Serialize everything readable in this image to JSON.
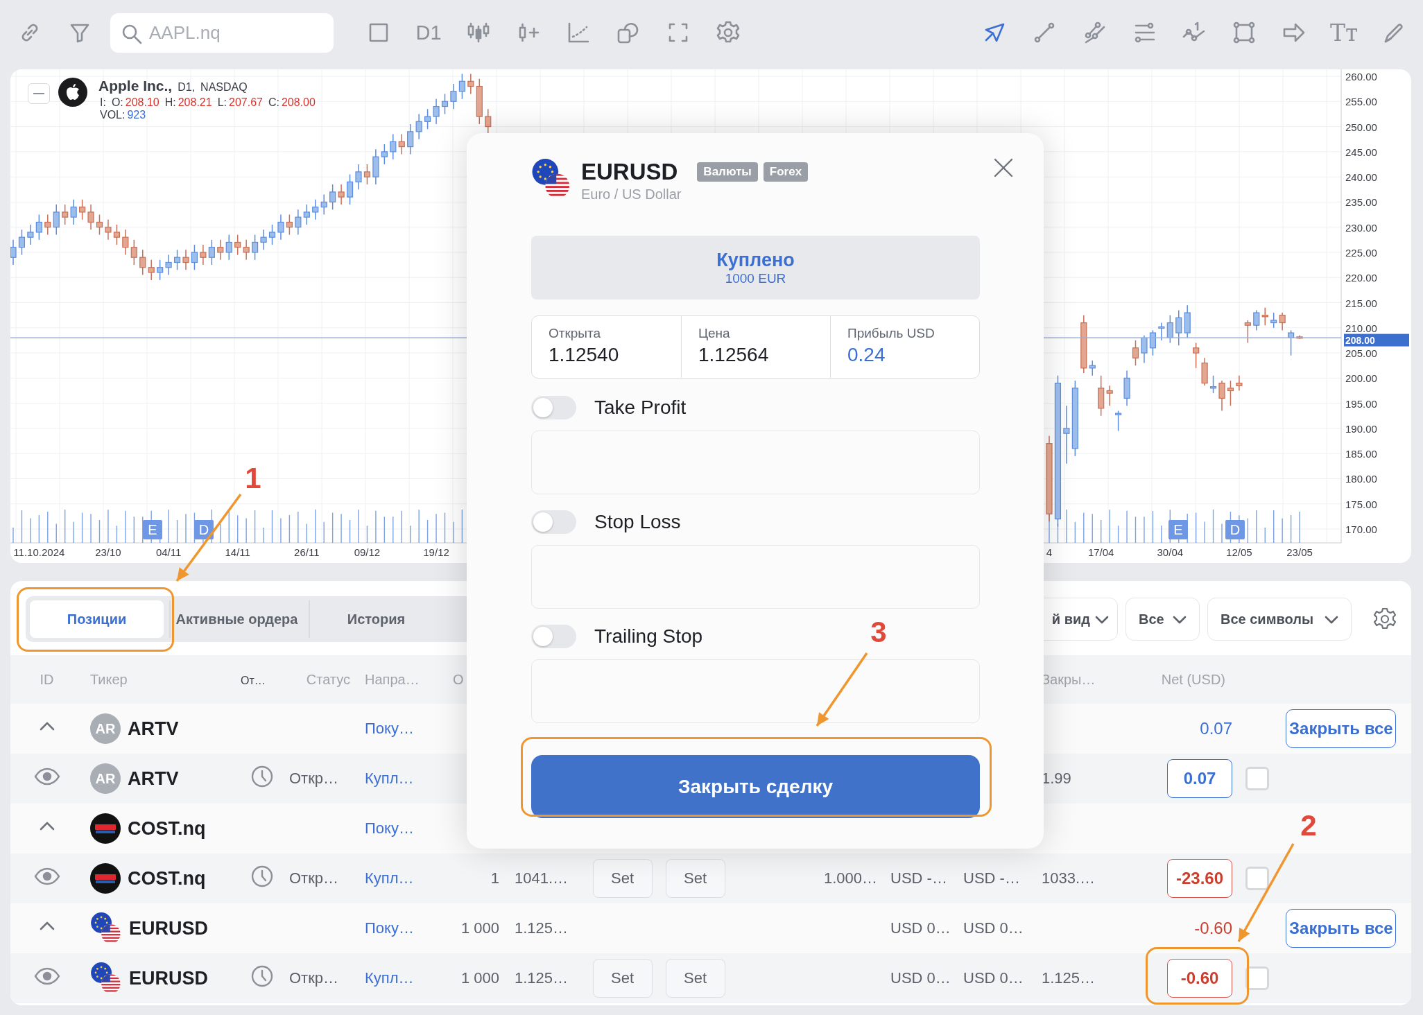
{
  "toolbar": {
    "search": {
      "placeholder": "AAPL.nq"
    },
    "timeframe": "D1",
    "tools": [
      {
        "selected": true
      },
      {
        "selected": false
      },
      {
        "selected": false
      },
      {
        "selected": false
      },
      {
        "selected": false
      },
      {
        "selected": false
      },
      {
        "selected": false
      },
      {
        "selected": false,
        "glyph": "Tт"
      },
      {
        "selected": false
      }
    ]
  },
  "chart": {
    "symbol": "Apple Inc.,",
    "timeframe": "D1,",
    "exchange": "NASDAQ",
    "prefix": "I:",
    "ohlc": [
      {
        "label": "O:",
        "value": "208.10"
      },
      {
        "label": "H:",
        "value": "208.21"
      },
      {
        "label": "L:",
        "value": "207.67"
      },
      {
        "label": "C:",
        "value": "208.00"
      }
    ],
    "volume": {
      "label": "VOL:",
      "value": "923"
    },
    "last_price": "208.00",
    "events": [
      {
        "label": "E"
      },
      {
        "label": "D"
      },
      {
        "label": "E"
      },
      {
        "label": "D"
      }
    ],
    "chart_data": {
      "type": "candlestick",
      "ylim": [
        167.25,
        261.38
      ],
      "grid": true,
      "ref_lines": [
        {
          "value": 208,
          "axis": "y"
        }
      ],
      "yticks": [
        {
          "value": 260,
          "label": "260.00"
        },
        {
          "value": 255,
          "label": "255.00"
        },
        {
          "value": 250,
          "label": "250.00"
        },
        {
          "value": 245,
          "label": "245.00"
        },
        {
          "value": 240,
          "label": "240.00"
        },
        {
          "value": 235,
          "label": "235.00"
        },
        {
          "value": 230,
          "label": "230.00"
        },
        {
          "value": 225,
          "label": "225.00"
        },
        {
          "value": 220,
          "label": "220.00"
        },
        {
          "value": 215,
          "label": "215.00"
        },
        {
          "value": 210,
          "label": "210.00"
        },
        {
          "value": 205,
          "label": "205.00"
        },
        {
          "value": 200,
          "label": "200.00"
        },
        {
          "value": 195,
          "label": "195.00"
        },
        {
          "value": 190,
          "label": "190.00"
        },
        {
          "value": 185,
          "label": "185.00"
        },
        {
          "value": 180,
          "label": "180.00"
        },
        {
          "value": 175,
          "label": "175.00"
        },
        {
          "value": 170,
          "label": "170.00"
        }
      ],
      "categories": [
        null,
        null,
        null,
        "11.10.2024",
        null,
        null,
        null,
        null,
        null,
        null,
        null,
        "23/10",
        null,
        null,
        null,
        null,
        null,
        null,
        "04/11",
        null,
        null,
        null,
        null,
        null,
        null,
        null,
        "14/11",
        null,
        null,
        null,
        null,
        null,
        null,
        null,
        "26/11",
        null,
        null,
        null,
        null,
        null,
        null,
        "09/12",
        null,
        null,
        null,
        null,
        null,
        null,
        null,
        "19/12",
        null,
        null,
        null,
        null,
        null,
        null,
        null,
        null,
        null,
        null,
        null,
        null,
        null,
        null,
        null,
        null,
        null,
        null,
        null,
        null,
        null,
        null,
        null,
        null,
        null,
        null,
        null,
        null,
        null,
        null,
        null,
        null,
        null,
        null,
        null,
        null,
        null,
        null,
        null,
        null,
        null,
        null,
        null,
        null,
        null,
        null,
        null,
        null,
        null,
        null,
        null,
        null,
        null,
        null,
        null,
        null,
        null,
        null,
        null,
        null,
        null,
        null,
        null,
        null,
        null,
        null,
        null,
        null,
        null,
        null,
        "4",
        null,
        null,
        null,
        null,
        null,
        "17/04",
        null,
        null,
        null,
        null,
        null,
        null,
        null,
        "30/04",
        null,
        null,
        null,
        null,
        null,
        null,
        null,
        "12/05",
        null,
        null,
        null,
        null,
        null,
        null,
        "23/05"
      ],
      "ohlc": [
        [
          224,
          227.5,
          222.5,
          226
        ],
        [
          226,
          229.5,
          224.5,
          228
        ],
        [
          228,
          230.5,
          226.5,
          229
        ],
        [
          229,
          232.5,
          227.5,
          231
        ],
        [
          231,
          232.5,
          228.5,
          230
        ],
        [
          230,
          234.5,
          228.5,
          233
        ],
        [
          233,
          234.5,
          230.5,
          232
        ],
        [
          232,
          235.5,
          230.5,
          234
        ],
        [
          234,
          235.5,
          231.5,
          233
        ],
        [
          233,
          234.5,
          229.5,
          231
        ],
        [
          231,
          232.5,
          228.5,
          230
        ],
        [
          230,
          231.5,
          227.5,
          229
        ],
        [
          229,
          230.5,
          226.5,
          228
        ],
        [
          228,
          229.5,
          224.5,
          226
        ],
        [
          226,
          227.5,
          222.5,
          224
        ],
        [
          224,
          225.5,
          220.5,
          222
        ],
        [
          222,
          223.5,
          219.5,
          221
        ],
        [
          221,
          223.5,
          219.5,
          222
        ],
        [
          222,
          224.5,
          220.5,
          223
        ],
        [
          223,
          225.5,
          221.5,
          224
        ],
        [
          224,
          225.5,
          221.5,
          223
        ],
        [
          223,
          226.5,
          221.5,
          225
        ],
        [
          225,
          226.5,
          222.5,
          224
        ],
        [
          224,
          227.5,
          222.5,
          226
        ],
        [
          226,
          227.5,
          223.5,
          225
        ],
        [
          225,
          228.5,
          223.5,
          227
        ],
        [
          227,
          228.5,
          224.5,
          226
        ],
        [
          226,
          227.5,
          223.5,
          225
        ],
        [
          225,
          228.5,
          223.5,
          227
        ],
        [
          227,
          229.5,
          225.5,
          228
        ],
        [
          228,
          230.5,
          226.5,
          229
        ],
        [
          229,
          232.5,
          227.5,
          231
        ],
        [
          231,
          232.5,
          228.5,
          230
        ],
        [
          230,
          233.5,
          228.5,
          232
        ],
        [
          232,
          234.5,
          230.5,
          233
        ],
        [
          233,
          235.5,
          231.5,
          234
        ],
        [
          234,
          236.5,
          232.5,
          235
        ],
        [
          235,
          238.5,
          233.5,
          237
        ],
        [
          237,
          238.5,
          234.5,
          236
        ],
        [
          236,
          240.5,
          234.5,
          239
        ],
        [
          239,
          242.5,
          237.5,
          241
        ],
        [
          241,
          242.5,
          238.5,
          240
        ],
        [
          240,
          245.5,
          238.5,
          244
        ],
        [
          244,
          246.5,
          242.5,
          245
        ],
        [
          245,
          248.5,
          243.5,
          247
        ],
        [
          247,
          248.5,
          244.5,
          246
        ],
        [
          246,
          250.5,
          244.5,
          249
        ],
        [
          249,
          252.5,
          247.5,
          251
        ],
        [
          251,
          253.5,
          249.5,
          252
        ],
        [
          252,
          255.5,
          250.5,
          254
        ],
        [
          254,
          256.5,
          252.5,
          255
        ],
        [
          255,
          258.5,
          253.5,
          257
        ],
        [
          257,
          260.5,
          255.5,
          259
        ],
        [
          259,
          260.5,
          256.5,
          258
        ],
        [
          258,
          259.5,
          250.5,
          252
        ],
        [
          252,
          253.5,
          248.5,
          250
        ],
        null,
        null,
        null,
        null,
        null,
        null,
        null,
        null,
        null,
        null,
        null,
        null,
        null,
        null,
        null,
        null,
        null,
        null,
        null,
        null,
        null,
        null,
        null,
        null,
        null,
        null,
        null,
        null,
        null,
        null,
        null,
        null,
        null,
        null,
        null,
        null,
        null,
        null,
        null,
        null,
        null,
        null,
        null,
        null,
        null,
        null,
        null,
        null,
        null,
        null,
        null,
        null,
        null,
        null,
        null,
        null,
        null,
        null,
        null,
        null,
        null,
        null,
        null,
        null,
        [
          187,
          188.5,
          171.5,
          173
        ],
        [
          172,
          200.5,
          170.5,
          199
        ],
        [
          189,
          194.5,
          183,
          190
        ],
        [
          186,
          199.5,
          184.5,
          198
        ],
        [
          211,
          212.5,
          201,
          202
        ],
        [
          202,
          203.5,
          200.5,
          202.5
        ],
        [
          198,
          200.5,
          192.5,
          194
        ],
        [
          197.5,
          198.5,
          194.5,
          197
        ],
        [
          193,
          193.5,
          189.5,
          193
        ],
        [
          196,
          201.5,
          194.5,
          200
        ],
        [
          206,
          207.5,
          202.5,
          204
        ],
        [
          205,
          208.5,
          203,
          208
        ],
        [
          206,
          209.5,
          204.5,
          209
        ],
        [
          210,
          211,
          207.5,
          210.2
        ],
        [
          208,
          212.5,
          207,
          211
        ],
        [
          209,
          213.5,
          206.5,
          212
        ],
        [
          209,
          214.5,
          208,
          213
        ],
        [
          206,
          207,
          202,
          205
        ],
        [
          203,
          204,
          198.5,
          199
        ],
        [
          198,
          200.5,
          197,
          198.3
        ],
        [
          199,
          199.5,
          193.5,
          196
        ],
        [
          198,
          199.5,
          194.5,
          197.5
        ],
        [
          199,
          200.5,
          197.5,
          198.5
        ],
        [
          211,
          211.5,
          207,
          210.5
        ],
        [
          210.5,
          213.5,
          209.5,
          213
        ],
        [
          212.5,
          214,
          210.5,
          212.2
        ],
        [
          211,
          213,
          210,
          211.5
        ],
        [
          212.5,
          213,
          209.5,
          211
        ],
        [
          208,
          209.5,
          204.5,
          209
        ],
        [
          208.2,
          208.5,
          207.8,
          208
        ]
      ]
    }
  },
  "positions_panel": {
    "tabs": [
      {
        "label": "Позиции",
        "selected": true
      },
      {
        "label": "Активные ордера",
        "selected": false
      },
      {
        "label": "История",
        "selected": false
      }
    ],
    "filters": [
      {
        "label": "й вид"
      },
      {
        "label": "Все"
      },
      {
        "label": "Все символы"
      }
    ],
    "columns": [
      "ID",
      "Тикер",
      "От…",
      "Статус",
      "Напра…",
      "О",
      "Закры…",
      "Net (USD)"
    ],
    "rows": [
      {
        "kind": "group",
        "expanded": true,
        "ticker": "ARTV",
        "logo": {
          "kind": "initials",
          "text": "AR"
        },
        "direction": "Поку…",
        "net": "0.07",
        "net_negative": false,
        "button": "Закрыть все"
      },
      {
        "kind": "position",
        "checked": false,
        "ticker": "ARTV",
        "logo": {
          "kind": "initials",
          "text": "AR"
        },
        "status": "Откр…",
        "direction": "Купл…",
        "close_price": "1.99",
        "net": "0.07",
        "net_negative": false
      },
      {
        "kind": "group",
        "expanded": true,
        "ticker": "COST.nq",
        "logo": {
          "kind": "dark_badge"
        },
        "direction": "Поку…"
      },
      {
        "kind": "position",
        "checked": false,
        "ticker": "COST.nq",
        "logo": {
          "kind": "dark_badge"
        },
        "status": "Откр…",
        "direction": "Купл…",
        "quantity": "1",
        "open_price": "1041.…",
        "take_profit": "Set",
        "stop_loss": "Set",
        "column_11": "1.000…",
        "column_12": "USD -…",
        "column_13": "USD -…",
        "close_price": "1033.…",
        "net": "-23.60",
        "net_negative": true
      },
      {
        "kind": "group",
        "expanded": true,
        "ticker": "EURUSD",
        "logo": {
          "kind": "flags"
        },
        "direction": "Поку…",
        "quantity": "1 000",
        "open_price": "1.125…",
        "column_12": "USD 0…",
        "column_13": "USD 0…",
        "net": "-0.60",
        "net_negative": true,
        "button": "Закрыть все"
      },
      {
        "kind": "position",
        "checked": false,
        "ticker": "EURUSD",
        "logo": {
          "kind": "flags"
        },
        "status": "Откр…",
        "direction": "Купл…",
        "quantity": "1 000",
        "open_price": "1.125…",
        "take_profit": "Set",
        "stop_loss": "Set",
        "column_12": "USD 0…",
        "column_13": "USD 0…",
        "close_price": "1.125…",
        "net": "-0.60",
        "net_negative": true
      }
    ]
  },
  "modal": {
    "symbol": "EURUSD",
    "tags": [
      "Валюты",
      "Forex"
    ],
    "description": "Euro / US Dollar",
    "side": {
      "label": "Куплено",
      "amount": "1000 EUR"
    },
    "stats": [
      {
        "label": "Открыта",
        "value": "1.12540",
        "highlight": false
      },
      {
        "label": "Цена",
        "value": "1.12564",
        "highlight": false
      },
      {
        "label": "Прибыль USD",
        "value": "0.24",
        "highlight": true
      }
    ],
    "toggles": [
      {
        "label": "Take Profit",
        "on": false
      },
      {
        "label": "Stop Loss",
        "on": false
      },
      {
        "label": "Trailing Stop",
        "on": false
      }
    ],
    "close_button": "Закрыть сделку"
  },
  "annotations": [
    {
      "number": "1"
    },
    {
      "number": "2"
    },
    {
      "number": "3"
    }
  ]
}
